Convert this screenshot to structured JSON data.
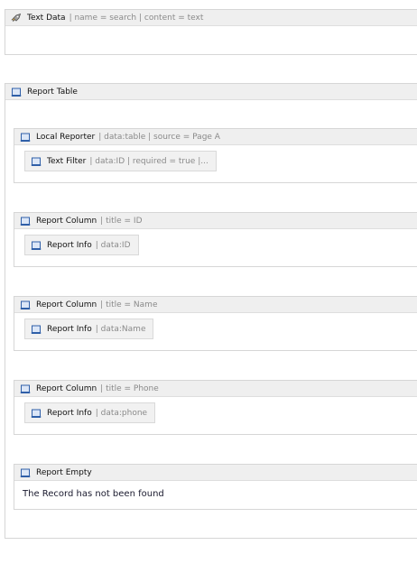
{
  "text_data": {
    "icon": "rocket-icon",
    "title": "Text Data",
    "props": "| name = search | content = text"
  },
  "report_table": {
    "icon": "scroll-icon",
    "title": "Report Table"
  },
  "local_reporter": {
    "icon": "scroll-icon",
    "title": "Local Reporter",
    "props": "| data:table | source = Page A"
  },
  "text_filter": {
    "icon": "scroll-icon",
    "title": "Text Filter",
    "props": "| data:ID | required = true |..."
  },
  "columns": [
    {
      "title": "Report Column",
      "props": "| title = ID",
      "info_title": "Report Info",
      "info_props": "| data:ID"
    },
    {
      "title": "Report Column",
      "props": "| title = Name",
      "info_title": "Report Info",
      "info_props": "| data:Name"
    },
    {
      "title": "Report Column",
      "props": "| title = Phone",
      "info_title": "Report Info",
      "info_props": "| data:phone"
    }
  ],
  "report_empty": {
    "icon": "scroll-icon",
    "title": "Report Empty",
    "message": "The Record has not been found"
  },
  "colors": {
    "icon_blue": "#2f5fa8",
    "header_bg": "#efefef",
    "border": "#d6d6d6"
  }
}
